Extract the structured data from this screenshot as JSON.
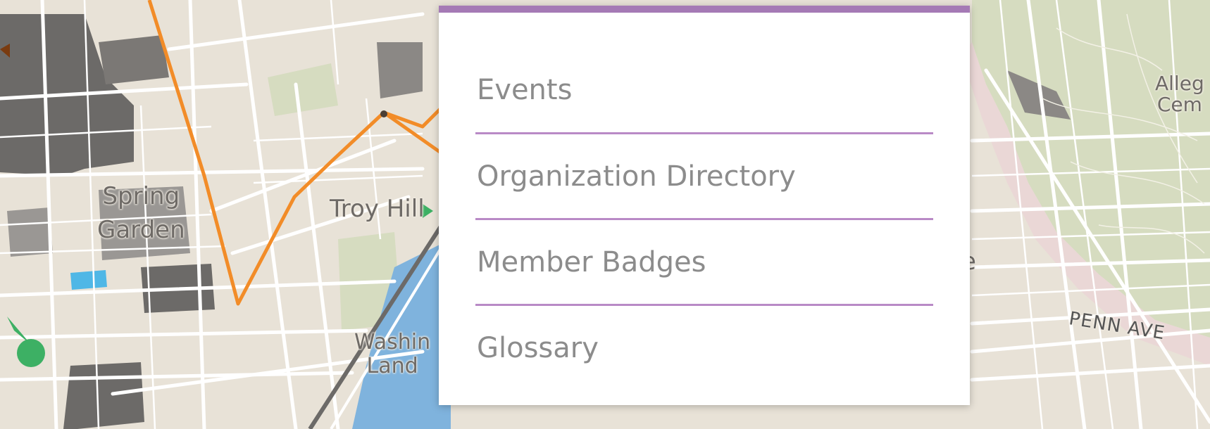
{
  "map": {
    "labels": {
      "spring_garden": "Spring\nGarden",
      "troy_hill": "Troy Hill",
      "washington_landing": "Washin\nLand",
      "allegheny_cemetery": "Alleg\nCem",
      "penn_ave": "PENN AVE",
      "partial_e": "e"
    },
    "colors": {
      "land": "#e8e2d7",
      "park": "#d5dbbd",
      "river": "#7fb3dd",
      "route": "#f28c28",
      "building": "#6b6866"
    }
  },
  "menu": {
    "accent_color": "#a57ab5",
    "items": [
      {
        "label": "Events"
      },
      {
        "label": "Organization Directory"
      },
      {
        "label": "Member Badges"
      },
      {
        "label": "Glossary"
      }
    ]
  }
}
